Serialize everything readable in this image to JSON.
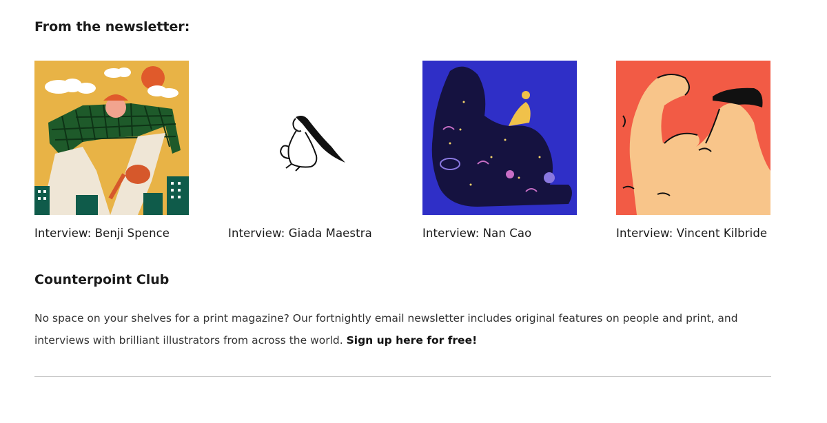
{
  "newsletter": {
    "heading": "From the newsletter:",
    "cards": [
      {
        "title": "Interview: Benji Spence",
        "icon": "benji-spence-illustration"
      },
      {
        "title": "Interview: Giada Maestra",
        "icon": "giada-maestra-illustration"
      },
      {
        "title": "Interview: Nan Cao",
        "icon": "nan-cao-illustration"
      },
      {
        "title": "Interview: Vincent Kilbride",
        "icon": "vincent-kilbride-illustration"
      }
    ]
  },
  "club": {
    "heading": "Counterpoint Club",
    "body": "No space on your shelves for a print magazine? Our fortnightly email newsletter includes original features on people and print, and interviews with brilliant illustrators from across the world. ",
    "link_label": "Sign up here for free!"
  },
  "colors": {
    "benji_bg": "#e8b346",
    "nan_bg": "#2f2fc7",
    "vincent_bg": "#f25b45",
    "rule": "#c9c9c9"
  }
}
